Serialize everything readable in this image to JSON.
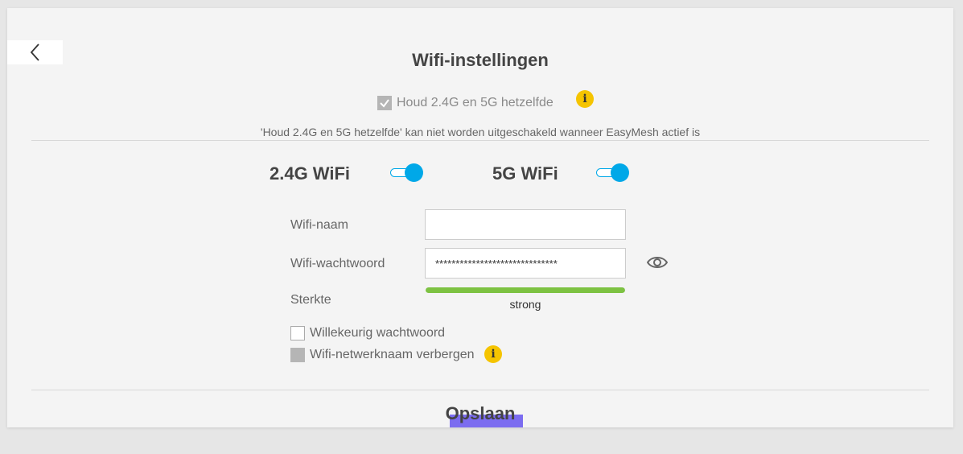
{
  "page": {
    "title": "Wifi-instellingen",
    "keep_same_label": "Houd 2.4G en 5G hetzelfde",
    "keep_same_checked": true,
    "keep_same_disabled": true,
    "info_symbol": "i",
    "easymesh_note": "'Houd 2.4G en 5G hetzelfde' kan niet worden uitgeschakeld wanneer EasyMesh actief is"
  },
  "bands": [
    {
      "label": "2.4G WiFi",
      "enabled": true
    },
    {
      "label": "5G WiFi",
      "enabled": true
    }
  ],
  "form": {
    "ssid_label": "Wifi-naam",
    "ssid_value": "",
    "password_label": "Wifi-wachtwoord",
    "password_value": "******************************",
    "strength_label": "Sterkte",
    "strength_value": "strong",
    "strength_level": 1.0,
    "random_password_label": "Willekeurig wachtwoord",
    "random_password_checked": false,
    "hide_ssid_label": "Wifi-netwerknaam verbergen",
    "hide_ssid_disabled": true
  },
  "actions": {
    "save_label": "Opslaan"
  },
  "icons": {
    "back": "chevron-left-icon",
    "info": "info-icon",
    "show_password": "eye-icon",
    "check": "check-icon"
  },
  "colors": {
    "toggle_accent": "#00a8e8",
    "info_yellow": "#f5c400",
    "strength_green": "#7dc242",
    "save_highlight": "#7b6cf0"
  }
}
